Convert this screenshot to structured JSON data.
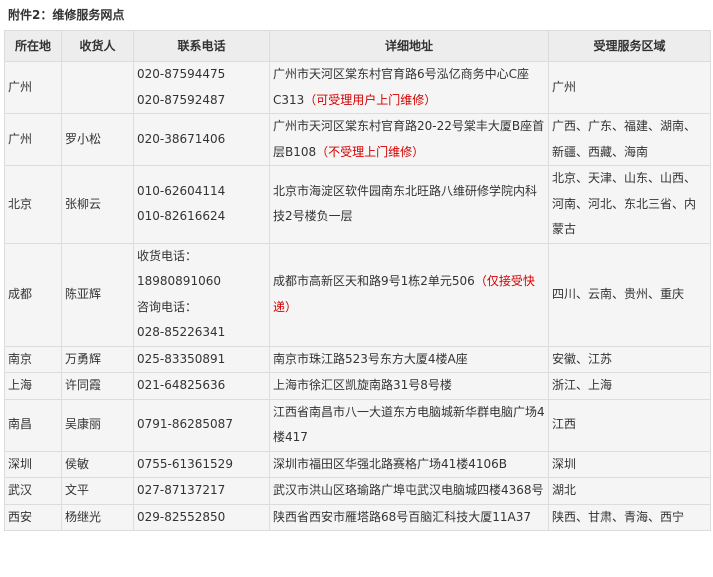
{
  "title": "附件2：维修服务网点",
  "headers": [
    "所在地",
    "收货人",
    "联系电话",
    "详细地址",
    "受理服务区域"
  ],
  "rows": [
    {
      "location": "广州",
      "receiver": "",
      "phones": [
        "020-87594475",
        "020-87592487"
      ],
      "address": "广州市天河区棠东村官育路6号泓亿商务中心C座C313",
      "note": "（可受理用户上门维修）",
      "area": "广州"
    },
    {
      "location": "广州",
      "receiver": "罗小松",
      "phones": [
        "020-38671406"
      ],
      "address": "广州市天河区棠东村官育路20-22号棠丰大厦B座首层B108",
      "note": "（不受理上门维修）",
      "area": "广西、广东、福建、湖南、新疆、西藏、海南"
    },
    {
      "location": "北京",
      "receiver": "张柳云",
      "phones": [
        "010-62604114",
        "010-82616624"
      ],
      "address": "北京市海淀区软件园南东北旺路八维研修学院内科技2号楼负一层",
      "note": "",
      "area": "北京、天津、山东、山西、河南、河北、东北三省、内蒙古"
    },
    {
      "location": "成都",
      "receiver": "陈亚辉",
      "phones": [
        "收货电话：",
        "18980891060",
        "咨询电话：",
        "028-85226341"
      ],
      "address": "成都市高新区天和路9号1栋2单元506",
      "note": "（仅接受快递）",
      "area": "四川、云南、贵州、重庆"
    },
    {
      "location": "南京",
      "receiver": "万勇辉",
      "phones": [
        "025-83350891"
      ],
      "address": "南京市珠江路523号东方大厦4楼A座",
      "note": "",
      "area": "安徽、江苏"
    },
    {
      "location": "上海",
      "receiver": "许同霞",
      "phones": [
        "021-64825636"
      ],
      "address": "上海市徐汇区凯旋南路31号8号楼",
      "note": "",
      "area": "浙江、上海"
    },
    {
      "location": "南昌",
      "receiver": "吴康丽",
      "phones": [
        "0791-86285087"
      ],
      "address": "江西省南昌市八一大道东方电脑城新华群电脑广场4楼417",
      "note": "",
      "area": "江西"
    },
    {
      "location": "深圳",
      "receiver": "侯敏",
      "phones": [
        "0755-61361529"
      ],
      "address": "深圳市福田区华强北路赛格广场41楼4106B",
      "note": "",
      "area": "深圳"
    },
    {
      "location": "武汉",
      "receiver": "文平",
      "phones": [
        "027-87137217"
      ],
      "address": "武汉市洪山区珞瑜路广埠屯武汉电脑城四楼4368号",
      "note": "",
      "area": "湖北"
    },
    {
      "location": "西安",
      "receiver": "杨继光",
      "phones": [
        "029-82552850"
      ],
      "address": "陕西省西安市雁塔路68号百脑汇科技大厦11A37",
      "note": "",
      "area": "陕西、甘肃、青海、西宁"
    }
  ]
}
